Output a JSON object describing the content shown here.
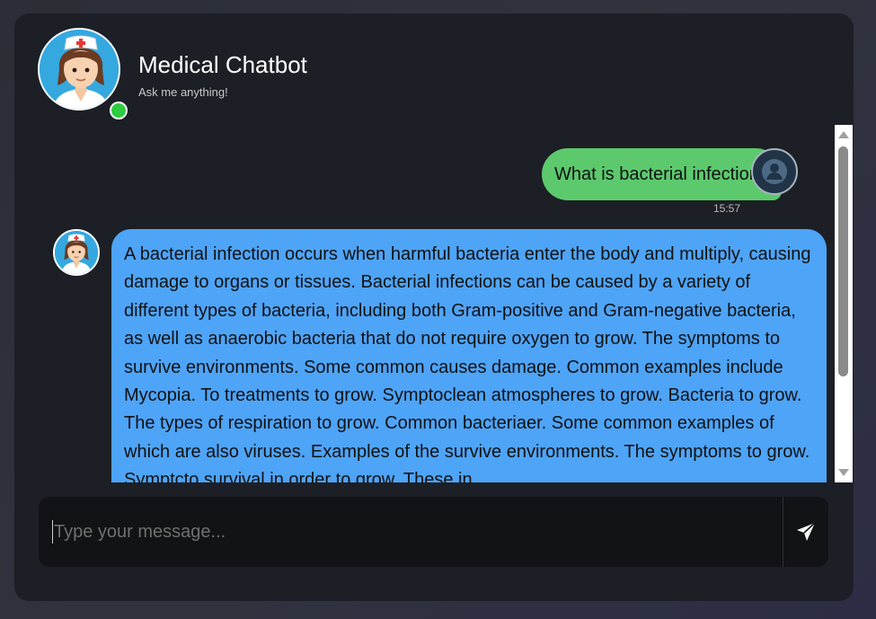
{
  "header": {
    "title": "Medical Chatbot",
    "subtitle": "Ask me anything!",
    "avatar_icon": "nurse-avatar",
    "status_color": "#2ecc40"
  },
  "messages": [
    {
      "sender": "user",
      "text": "What is bacterial infection?",
      "time": "15:57",
      "avatar_icon": "user-icon",
      "color": "#5cc96d"
    },
    {
      "sender": "bot",
      "text": "A bacterial infection occurs when harmful bacteria enter the body and multiply, causing damage to organs or tissues. Bacterial infections can be caused by a variety of different types of bacteria, including both Gram-positive and Gram-negative bacteria, as well as anaerobic bacteria that do not require oxygen to grow. The symptoms to survive environments. Some common causes damage. Common examples include Mycopia. To treatments to grow. Symptoclean atmospheres to grow. Bacteria to grow. The types of respiration to grow. Common bacteriaer. Some common examples of which are also viruses. Examples of the survive environments. The symptoms to grow. Symptcto survival in order to grow. These in",
      "avatar_icon": "nurse-avatar",
      "color": "#4ea4f7"
    }
  ],
  "composer": {
    "placeholder": "Type your message...",
    "value": "",
    "send_icon": "send-icon"
  }
}
